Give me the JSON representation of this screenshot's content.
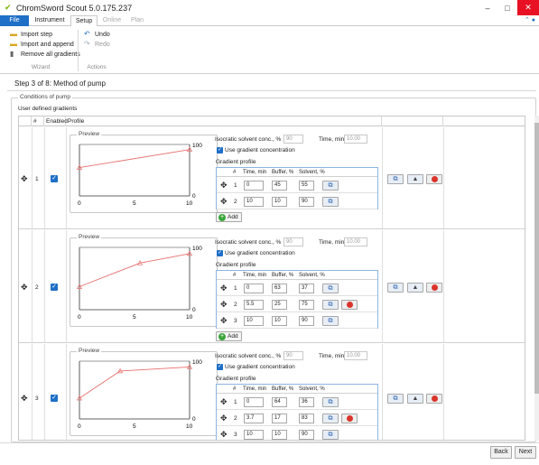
{
  "window": {
    "title": "ChromSword Scout 5.0.175.237"
  },
  "tabs": {
    "file": "File",
    "instrument": "Instrument",
    "setup": "Setup",
    "online": "Online",
    "plan": "Plan"
  },
  "ribbon": {
    "import_step": "Import step",
    "import_append": "Import and append",
    "remove_all": "Remove all gradients",
    "undo": "Undo",
    "redo": "Redo",
    "group_wizard": "Wizard",
    "group_actions": "Actions"
  },
  "step_title": "Step 3 of 8: Method of pump",
  "conditions_legend": "Conditions of pump",
  "udg_label": "User defined gradients",
  "grid_headers": {
    "hash": "#",
    "enabled": "Enabled",
    "profile": "Profile"
  },
  "labels": {
    "preview": "Preview",
    "iso_conc": "Isocratic solvent conc., %",
    "time_min": "Time, min",
    "use_grad": "Use gradient concentration",
    "grad_profile": "Gradient profile",
    "add": "Add"
  },
  "gp_headers": {
    "hash": "#",
    "time": "Time, min",
    "buffer": "Buffer, %",
    "solvent": "Solvent, %"
  },
  "gradients": [
    {
      "num": "1",
      "iso": "90",
      "time": "10.00",
      "steps": [
        {
          "n": "1",
          "time": "0",
          "buffer": "45",
          "solvent": "55"
        },
        {
          "n": "2",
          "time": "10",
          "buffer": "10",
          "solvent": "90"
        }
      ],
      "chart_ticks": {
        "y_top": "100",
        "y_bottom": "0",
        "x0": "0",
        "x5": "5",
        "x10": "10"
      }
    },
    {
      "num": "2",
      "iso": "90",
      "time": "10.00",
      "steps": [
        {
          "n": "1",
          "time": "0",
          "buffer": "63",
          "solvent": "37"
        },
        {
          "n": "2",
          "time": "5.5",
          "buffer": "25",
          "solvent": "75"
        },
        {
          "n": "3",
          "time": "10",
          "buffer": "10",
          "solvent": "90"
        }
      ],
      "chart_ticks": {
        "y_top": "100",
        "y_bottom": "0",
        "x0": "0",
        "x5": "5",
        "x10": "10"
      }
    },
    {
      "num": "3",
      "iso": "90",
      "time": "10.00",
      "steps": [
        {
          "n": "1",
          "time": "0",
          "buffer": "64",
          "solvent": "36"
        },
        {
          "n": "2",
          "time": "3.7",
          "buffer": "17",
          "solvent": "83"
        },
        {
          "n": "3",
          "time": "10",
          "buffer": "10",
          "solvent": "90"
        }
      ],
      "chart_ticks": {
        "y_top": "100",
        "y_bottom": "0",
        "x0": "0",
        "x5": "5",
        "x10": "10"
      }
    }
  ],
  "footer": {
    "back": "Back",
    "next": "Next"
  },
  "colors": {
    "accent": "#1e6fc6",
    "chart_line": "#e8706e"
  }
}
